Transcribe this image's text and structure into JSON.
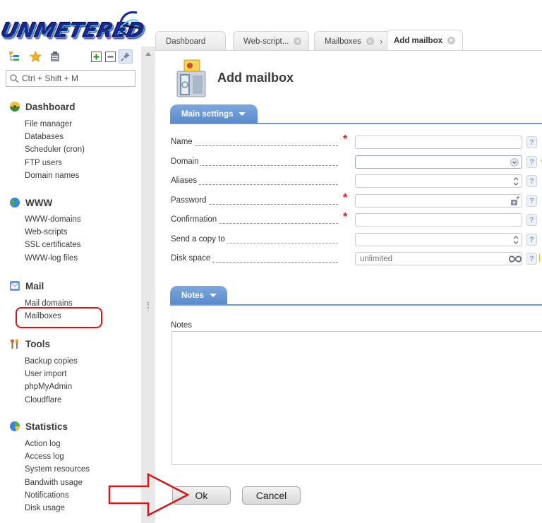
{
  "sidebar": {
    "logo_text": "UNMETERED",
    "search_placeholder": "Ctrl + Shift + M",
    "groups": [
      {
        "title": "Dashboard",
        "items": [
          "File manager",
          "Databases",
          "Scheduler (cron)",
          "FTP users",
          "Domain names"
        ]
      },
      {
        "title": "WWW",
        "items": [
          "WWW-domains",
          "Web-scripts",
          "SSL certificates",
          "WWW-log files"
        ]
      },
      {
        "title": "Mail",
        "items": [
          "Mail domains",
          "Mailboxes"
        ]
      },
      {
        "title": "Tools",
        "items": [
          "Backup copies",
          "User import",
          "phpMyAdmin",
          "Cloudflare"
        ]
      },
      {
        "title": "Statistics",
        "items": [
          "Action log",
          "Access log",
          "System resources",
          "Bandwith usage",
          "Notifications",
          "Disk usage"
        ]
      }
    ],
    "highlighted_item": "Mailboxes"
  },
  "tabs": [
    {
      "label": "Dashboard",
      "closable": false
    },
    {
      "label": "Web-script...",
      "closable": true
    },
    {
      "label": "Mailboxes",
      "closable": true
    },
    {
      "label": "Add mailbox",
      "closable": true,
      "active": true
    }
  ],
  "tab_separator": "›",
  "page": {
    "title": "Add mailbox",
    "main_settings_label": "Main settings",
    "notes_section_label": "Notes",
    "notes_label": "Notes",
    "notes_value": ""
  },
  "form": {
    "fields": [
      {
        "label": "Name",
        "required": true,
        "value": "",
        "type": "text"
      },
      {
        "label": "Domain",
        "required": false,
        "value": "",
        "type": "select"
      },
      {
        "label": "Aliases",
        "required": false,
        "value": "",
        "type": "list"
      },
      {
        "label": "Password",
        "required": true,
        "value": "",
        "type": "password"
      },
      {
        "label": "Confirmation",
        "required": true,
        "value": "",
        "type": "password"
      },
      {
        "label": "Send a copy to",
        "required": false,
        "value": "",
        "type": "list"
      },
      {
        "label": "Disk space",
        "required": false,
        "value": "unlimited",
        "type": "quota"
      }
    ],
    "help_glyph": "?",
    "required_glyph": "*"
  },
  "buttons": {
    "ok": "Ok",
    "cancel": "Cancel"
  },
  "colors": {
    "accent": "#5a8acd",
    "annotation_red": "#d0181b",
    "required": "#d42020"
  }
}
